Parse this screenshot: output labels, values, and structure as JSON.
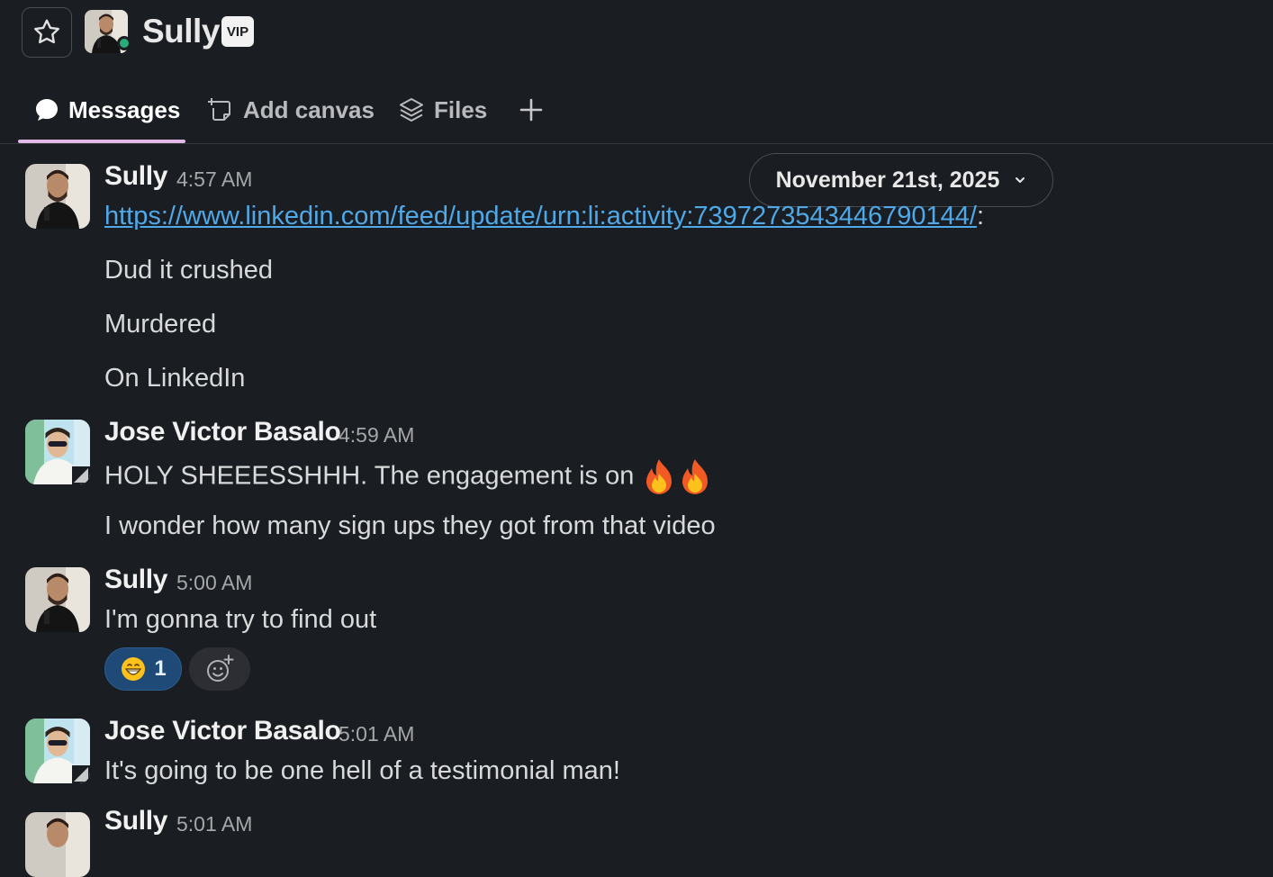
{
  "header": {
    "name": "Sully",
    "badge": "VIP"
  },
  "tabs": [
    {
      "label": "Messages",
      "icon": "message-bubble-icon",
      "active": true
    },
    {
      "label": "Add canvas",
      "icon": "canvas-icon"
    },
    {
      "label": "Files",
      "icon": "layers-icon"
    },
    {
      "label": "",
      "icon": "plus-icon"
    }
  ],
  "date_divider": "November 21st, 2025",
  "messages": [
    {
      "sender": "Sully",
      "time": "4:57 AM",
      "link": "https://www.linkedin.com/feed/update/urn:li:activity:7397273543446790144/",
      "link_suffix": ":",
      "lines": [
        "Dud it crushed",
        "Murdered",
        "On LinkedIn"
      ]
    },
    {
      "sender": "Jose Victor Basalo",
      "time": "4:59 AM",
      "lines": [
        "HOLY SHEEESSHHH. The engagement is on",
        "I wonder how many sign ups they got from that video"
      ]
    },
    {
      "sender": "Sully",
      "time": "5:00 AM",
      "lines": [
        "I'm gonna try to find out"
      ],
      "reaction": {
        "emoji": "grinning-face",
        "count": "1"
      }
    },
    {
      "sender": "Jose Victor Basalo",
      "time": "5:01 AM",
      "lines": [
        "It's going to be one hell of a testimonial man!"
      ]
    },
    {
      "sender": "Sully",
      "time": "5:01 AM"
    }
  ],
  "colors": {
    "background": "#1a1d21",
    "link": "#4fa8e8",
    "tab_underline": "#e2b8e6",
    "presence": "#2bac76",
    "reaction_bg": "#1f4a78"
  }
}
